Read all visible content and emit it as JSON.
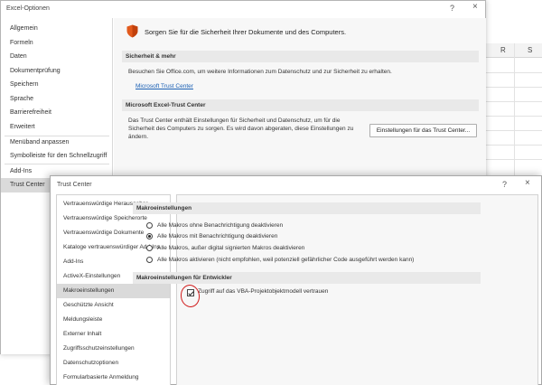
{
  "excel": {
    "col_r": "R",
    "col_s": "S"
  },
  "options_window": {
    "title": "Excel-Optionen",
    "help": "?",
    "close": "×",
    "nav": [
      "Allgemein",
      "Formeln",
      "Daten",
      "Dokumentprüfung",
      "Speichern",
      "Sprache",
      "Barrierefreiheit",
      "Erweitert",
      "Menüband anpassen",
      "Symbolleiste für den Schnellzugriff",
      "Add-Ins",
      "Trust Center"
    ],
    "active_nav": "Trust Center",
    "headline": "Sorgen Sie für die Sicherheit Ihrer Dokumente und des Computers.",
    "section1_title": "Sicherheit & mehr",
    "section1_text": "Besuchen Sie Office.com, um weitere Informationen zum Datenschutz und zur Sicherheit zu erhalten.",
    "section1_link": "Microsoft Trust Center",
    "section2_title": "Microsoft Excel-Trust Center",
    "section2_text_line1": "Das Trust Center enthält Einstellungen für Sicherheit und Datenschutz, um für die",
    "section2_text_line2": "Sicherheit des Computers zu sorgen. Es wird davon abgeraten, diese Einstellungen zu",
    "section2_text_line3": "ändern.",
    "trust_center_button": "Einstellungen für das Trust Center..."
  },
  "trust_window": {
    "title": "Trust Center",
    "help": "?",
    "close": "×",
    "nav": [
      "Vertrauenswürdige Herausgeber",
      "Vertrauenswürdige Speicherorte",
      "Vertrauenswürdige Dokumente",
      "Kataloge vertrauenswürdiger Add-Ins",
      "Add-Ins",
      "ActiveX-Einstellungen",
      "Makroeinstellungen",
      "Geschützte Ansicht",
      "Meldungsleiste",
      "Externer Inhalt",
      "Zugriffsschutzeinstellungen",
      "Datenschutzoptionen",
      "Formularbasierte Anmeldung"
    ],
    "active_nav": "Makroeinstellungen",
    "macro_section_title": "Makroeinstellungen",
    "macro_options": [
      "Alle Makros ohne Benachrichtigung deaktivieren",
      "Alle Makros mit Benachrichtigung deaktivieren",
      "Alle Makros, außer digital signierten Makros deaktivieren",
      "Alle Makros aktivieren (nicht empfohlen, weil potenziell gefährlicher Code ausgeführt werden kann)"
    ],
    "selected_macro_option_index": 1,
    "dev_section_title": "Makroeinstellungen für Entwickler",
    "vba_checkbox_label": "Zugriff auf das VBA-Projektobjektmodell vertrauen",
    "vba_checkbox_checked": true
  },
  "colors": {
    "accent_red": "#d11c1c",
    "shield_orange": "#e25a1c",
    "link_blue": "#1a5fb4"
  }
}
